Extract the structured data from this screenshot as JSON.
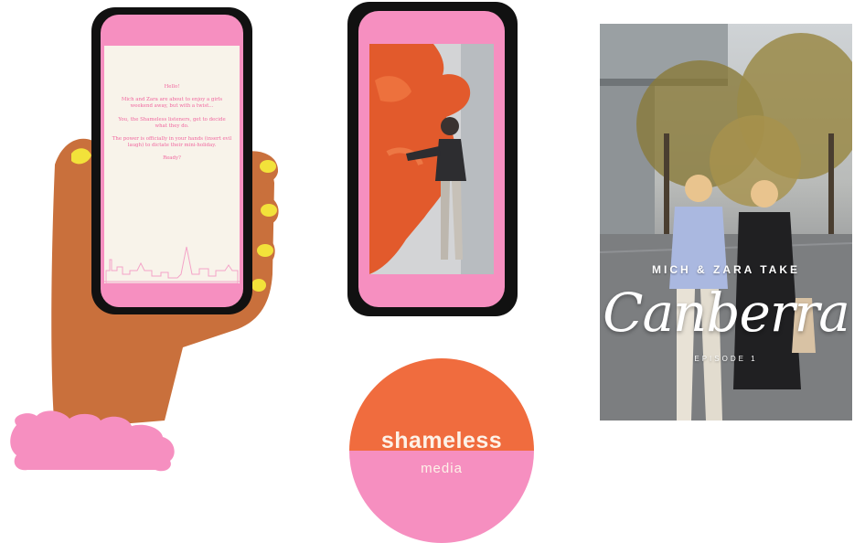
{
  "phone_message": {
    "paragraphs": [
      "Hello!",
      "Mich and Zara are about to enjoy a girls weekend away, but with a twist...",
      "You, the Shameless listeners, get to decide what they do.",
      "The power is officially in your hands (insert evil laugh) to dictate their mini-holiday.",
      "Ready?"
    ]
  },
  "logo": {
    "word": "shameless",
    "sub": "media"
  },
  "poster": {
    "top_text": "MICH & ZARA TAKE",
    "title": "Canberra",
    "episode": "EPISODE 1"
  },
  "colors": {
    "pink": "#f68fc0",
    "orange": "#f06c3e",
    "skin": "#c9703c",
    "nail": "#f2e23a",
    "cream": "#f8f3ea"
  }
}
